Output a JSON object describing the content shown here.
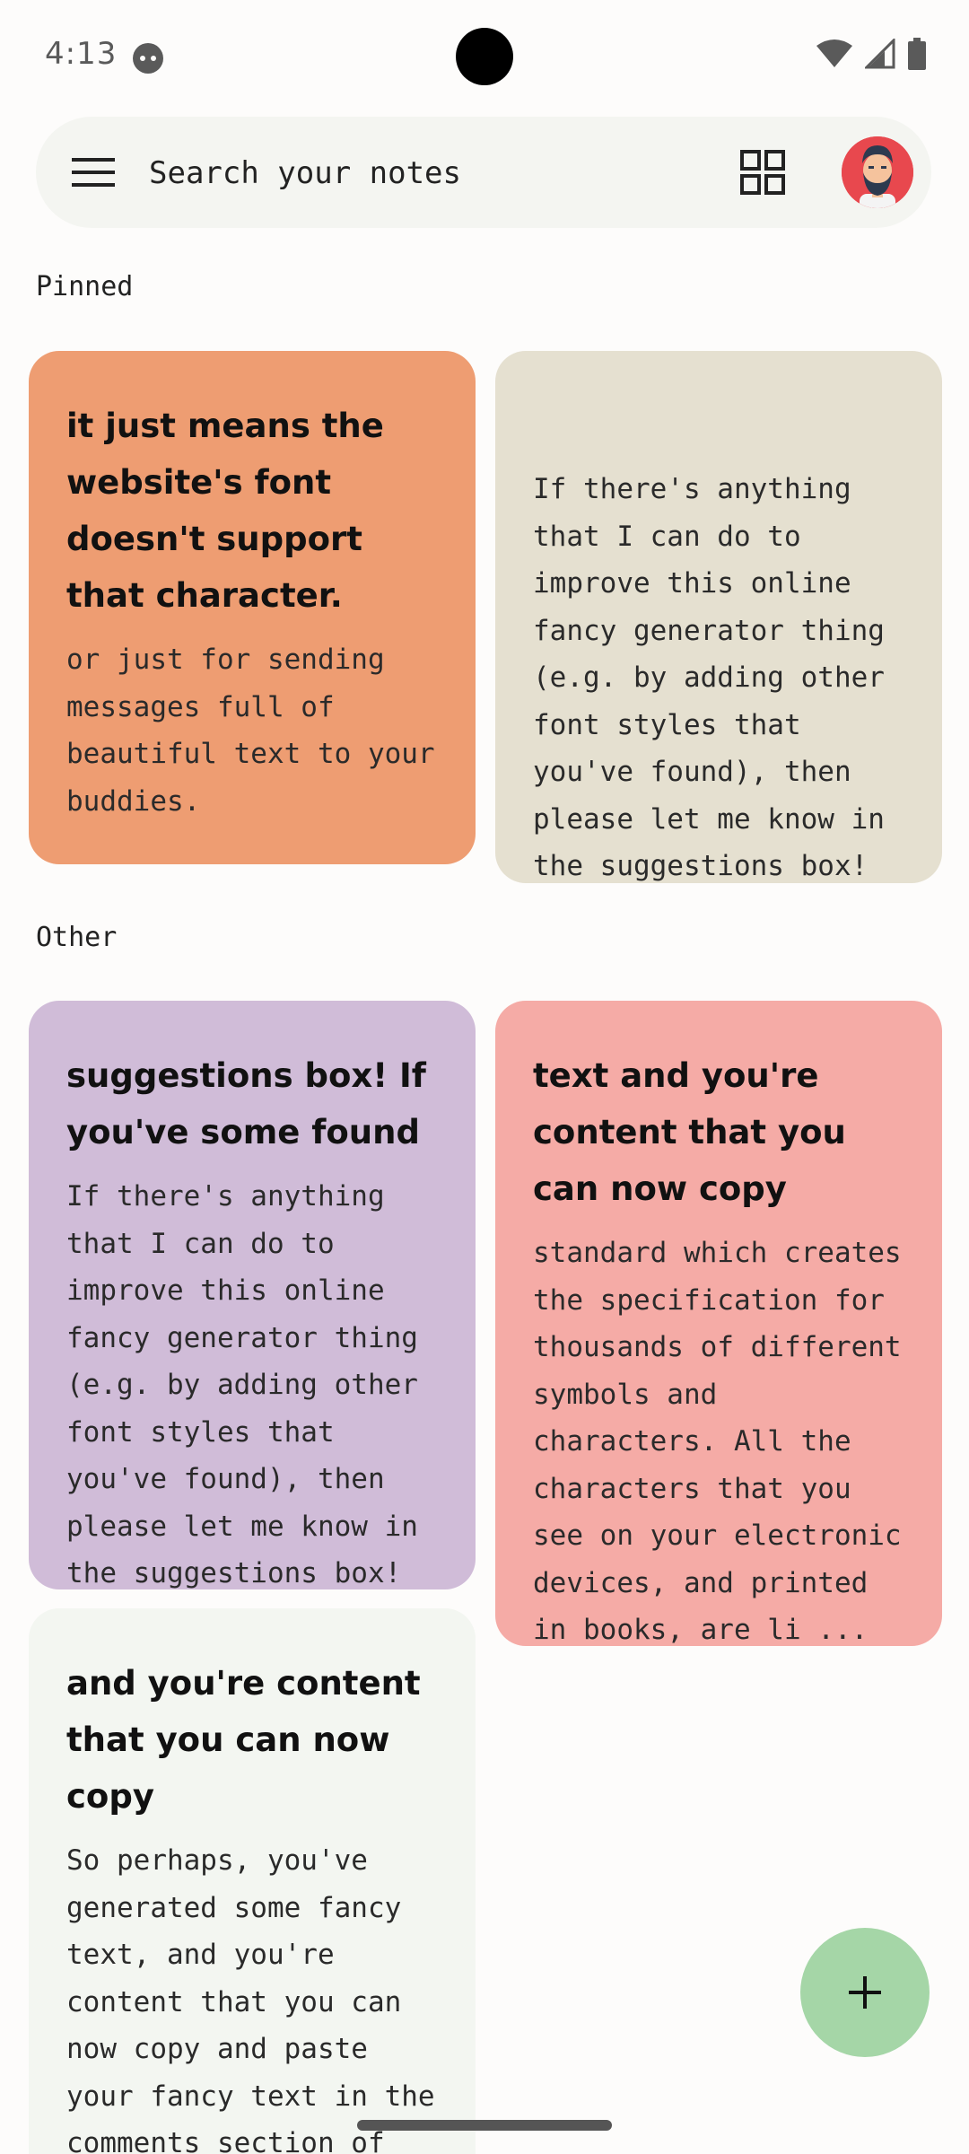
{
  "status_bar": {
    "time": "4:13"
  },
  "search": {
    "placeholder": "Search your notes",
    "value": ""
  },
  "sections": {
    "pinned": "Pinned",
    "other": "Other"
  },
  "notes": [
    {
      "title": "it just means the website's font doesn't support that character.",
      "body": "or just for sending messages full of beautiful text to your buddies.",
      "color": "#ee9d72"
    },
    {
      "title": "",
      "body": "If there's anything that I can do to improve this online fancy generator thing (e.g. by adding other font styles that you've found), then please let me know in the suggestions box! ...",
      "color": "#e5e0d0"
    },
    {
      "title": "suggestions box! If you've some found",
      "body": "If there's anything that I can do to improve this online fancy generator thing (e.g. by adding other font styles that you've found), then please let me know in the suggestions box! ...",
      "color": "#d0bcd8"
    },
    {
      "title": "text and you're content that you can now copy",
      "body": "standard which creates the specification for thousands of different symbols and characters. All the characters that you see on your electronic devices, and printed in books, are li ...",
      "color": "#f5aba6"
    },
    {
      "title": "and you're content that you can now copy",
      "body": "So perhaps, you've generated some fancy text, and you're content that you can now copy and paste your fancy text in the comments section of funny cat videos, but",
      "color": "#f3f6f1"
    }
  ],
  "colors": {
    "fab": "#a5d6a7",
    "search_bar": "#f4f5f1",
    "avatar_bg": "#e8484e"
  },
  "icons": {
    "menu": "menu-icon",
    "grid": "grid-view-icon",
    "fab": "plus-icon",
    "avatar": "avatar"
  }
}
